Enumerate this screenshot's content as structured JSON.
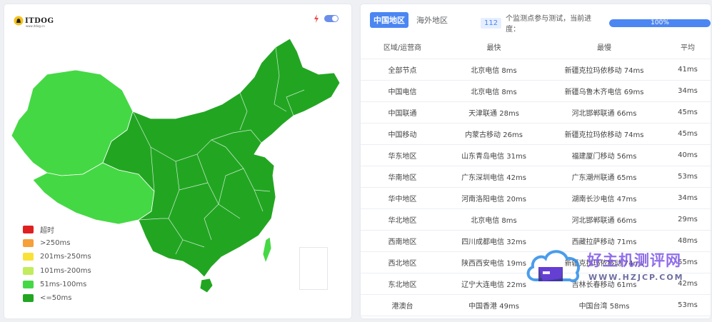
{
  "map_panel": {
    "logo": {
      "text": "ITDOG",
      "subtext": "www.itdog.cn"
    },
    "legend": [
      {
        "label": "超时",
        "color": "#e02020"
      },
      {
        "label": ">250ms",
        "color": "#f5a03a"
      },
      {
        "label": "201ms-250ms",
        "color": "#f8e23a"
      },
      {
        "label": "101ms-200ms",
        "color": "#c2ec5c"
      },
      {
        "label": "51ms-100ms",
        "color": "#45d845"
      },
      {
        "label": "<=50ms",
        "color": "#22a622"
      }
    ],
    "colors": {
      "fast": "#22a622",
      "medium": "#45d845"
    }
  },
  "table_panel": {
    "tabs": [
      {
        "label": "中国地区",
        "active": true
      },
      {
        "label": "海外地区",
        "active": false
      }
    ],
    "node_count": "112",
    "progress_text": "个监测点参与测试，当前进度：",
    "progress_percent": 100,
    "progress_label": "100%",
    "columns": [
      "区域/运营商",
      "最快",
      "最慢",
      "平均"
    ],
    "rows": [
      {
        "region": "全部节点",
        "fastest": "北京电信 8ms",
        "slowest": "新疆克拉玛依移动 74ms",
        "avg": "41ms"
      },
      {
        "region": "中国电信",
        "fastest": "北京电信 8ms",
        "slowest": "新疆乌鲁木齐电信 69ms",
        "avg": "34ms"
      },
      {
        "region": "中国联通",
        "fastest": "天津联通 28ms",
        "slowest": "河北邯郸联通 66ms",
        "avg": "45ms"
      },
      {
        "region": "中国移动",
        "fastest": "内蒙古移动 26ms",
        "slowest": "新疆克拉玛依移动 74ms",
        "avg": "45ms"
      },
      {
        "region": "华东地区",
        "fastest": "山东青岛电信 31ms",
        "slowest": "福建厦门移动 56ms",
        "avg": "40ms"
      },
      {
        "region": "华南地区",
        "fastest": "广东深圳电信 42ms",
        "slowest": "广东潮州联通 65ms",
        "avg": "53ms"
      },
      {
        "region": "华中地区",
        "fastest": "河南洛阳电信 20ms",
        "slowest": "湖南长沙电信 47ms",
        "avg": "34ms"
      },
      {
        "region": "华北地区",
        "fastest": "北京电信 8ms",
        "slowest": "河北邯郸联通 66ms",
        "avg": "29ms"
      },
      {
        "region": "西南地区",
        "fastest": "四川成都电信 32ms",
        "slowest": "西藏拉萨移动 71ms",
        "avg": "48ms"
      },
      {
        "region": "西北地区",
        "fastest": "陕西西安电信 19ms",
        "slowest": "新疆克拉玛依移动 74ms",
        "avg": "55ms"
      },
      {
        "region": "东北地区",
        "fastest": "辽宁大连电信 22ms",
        "slowest": "吉林长春移动 61ms",
        "avg": "42ms"
      },
      {
        "region": "港澳台",
        "fastest": "中国香港 49ms",
        "slowest": "中国台湾 58ms",
        "avg": "53ms"
      }
    ]
  },
  "watermark": {
    "text": "好主机测评网",
    "url": "WWW.HZJCP.COM"
  }
}
